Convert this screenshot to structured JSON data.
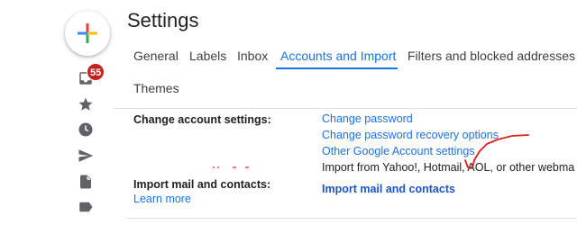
{
  "app": {
    "title": "Settings"
  },
  "tabs": [
    {
      "label": "General"
    },
    {
      "label": "Labels"
    },
    {
      "label": "Inbox"
    },
    {
      "label": "Accounts and Import"
    },
    {
      "label": "Filters and blocked addresses"
    },
    {
      "label": "Themes"
    }
  ],
  "active_tab": "Accounts and Import",
  "sidebar": {
    "inbox_badge": "55",
    "icons": [
      "compose-plus-icon",
      "inbox-icon",
      "star-icon",
      "clock-icon",
      "send-icon",
      "file-icon",
      "label-icon"
    ]
  },
  "sections": {
    "change_account": {
      "label": "Change account settings:",
      "links": [
        "Change password",
        "Change password recovery options",
        "Other Google Account settings"
      ]
    },
    "import_mail": {
      "label": "Import mail and contacts:",
      "description": "Import from Yahoo!, Hotmail, AOL, or other webma",
      "action": "Import mail and contacts",
      "learn_more": "Learn more"
    }
  },
  "colors": {
    "accent": "#1a73e8",
    "badge": "#c5221f",
    "annotation": "#e0201c"
  }
}
